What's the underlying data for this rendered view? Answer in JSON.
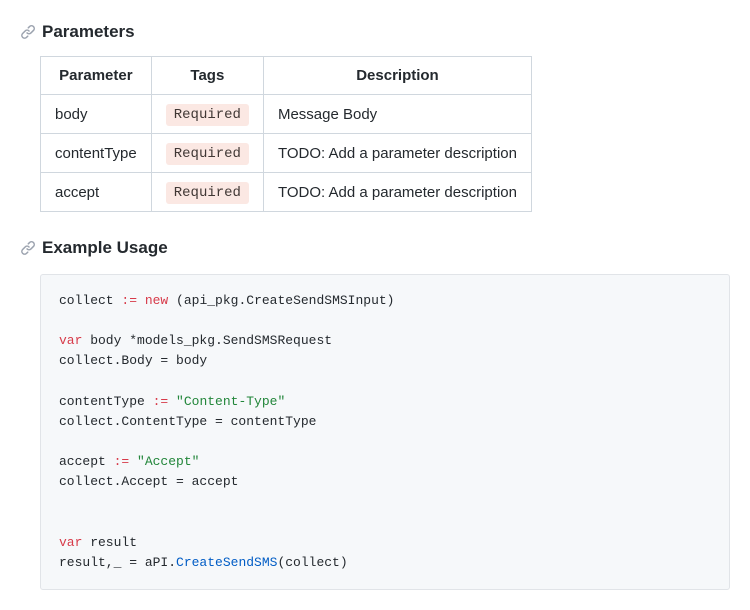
{
  "headings": {
    "parameters": "Parameters",
    "example": "Example Usage"
  },
  "table": {
    "headers": {
      "param": "Parameter",
      "tags": "Tags",
      "desc": "Description"
    },
    "rows": [
      {
        "param": "body",
        "tag": "Required",
        "desc": "Message Body"
      },
      {
        "param": "contentType",
        "tag": "Required",
        "desc": "TODO: Add a parameter description"
      },
      {
        "param": "accept",
        "tag": "Required",
        "desc": "TODO: Add a parameter description"
      }
    ]
  },
  "code": {
    "l1a": "collect ",
    "l1_op": ":=",
    "l1_kw": " new",
    "l1b": " (api_pkg.CreateSendSMSInput)",
    "l3_kw": "var",
    "l3a": " body *models_pkg.SendSMSRequest",
    "l4": "collect.Body = body",
    "l6a": "contentType ",
    "l6_op": ":=",
    "l6_str": " \"Content-Type\"",
    "l7": "collect.ContentType = contentType",
    "l9a": "accept ",
    "l9_op": ":=",
    "l9_str": " \"Accept\"",
    "l10": "collect.Accept = accept",
    "l13_kw": "var",
    "l13a": " result",
    "l14a": "result,_ = aPI.",
    "l14_fn": "CreateSendSMS",
    "l14b": "(collect)"
  }
}
